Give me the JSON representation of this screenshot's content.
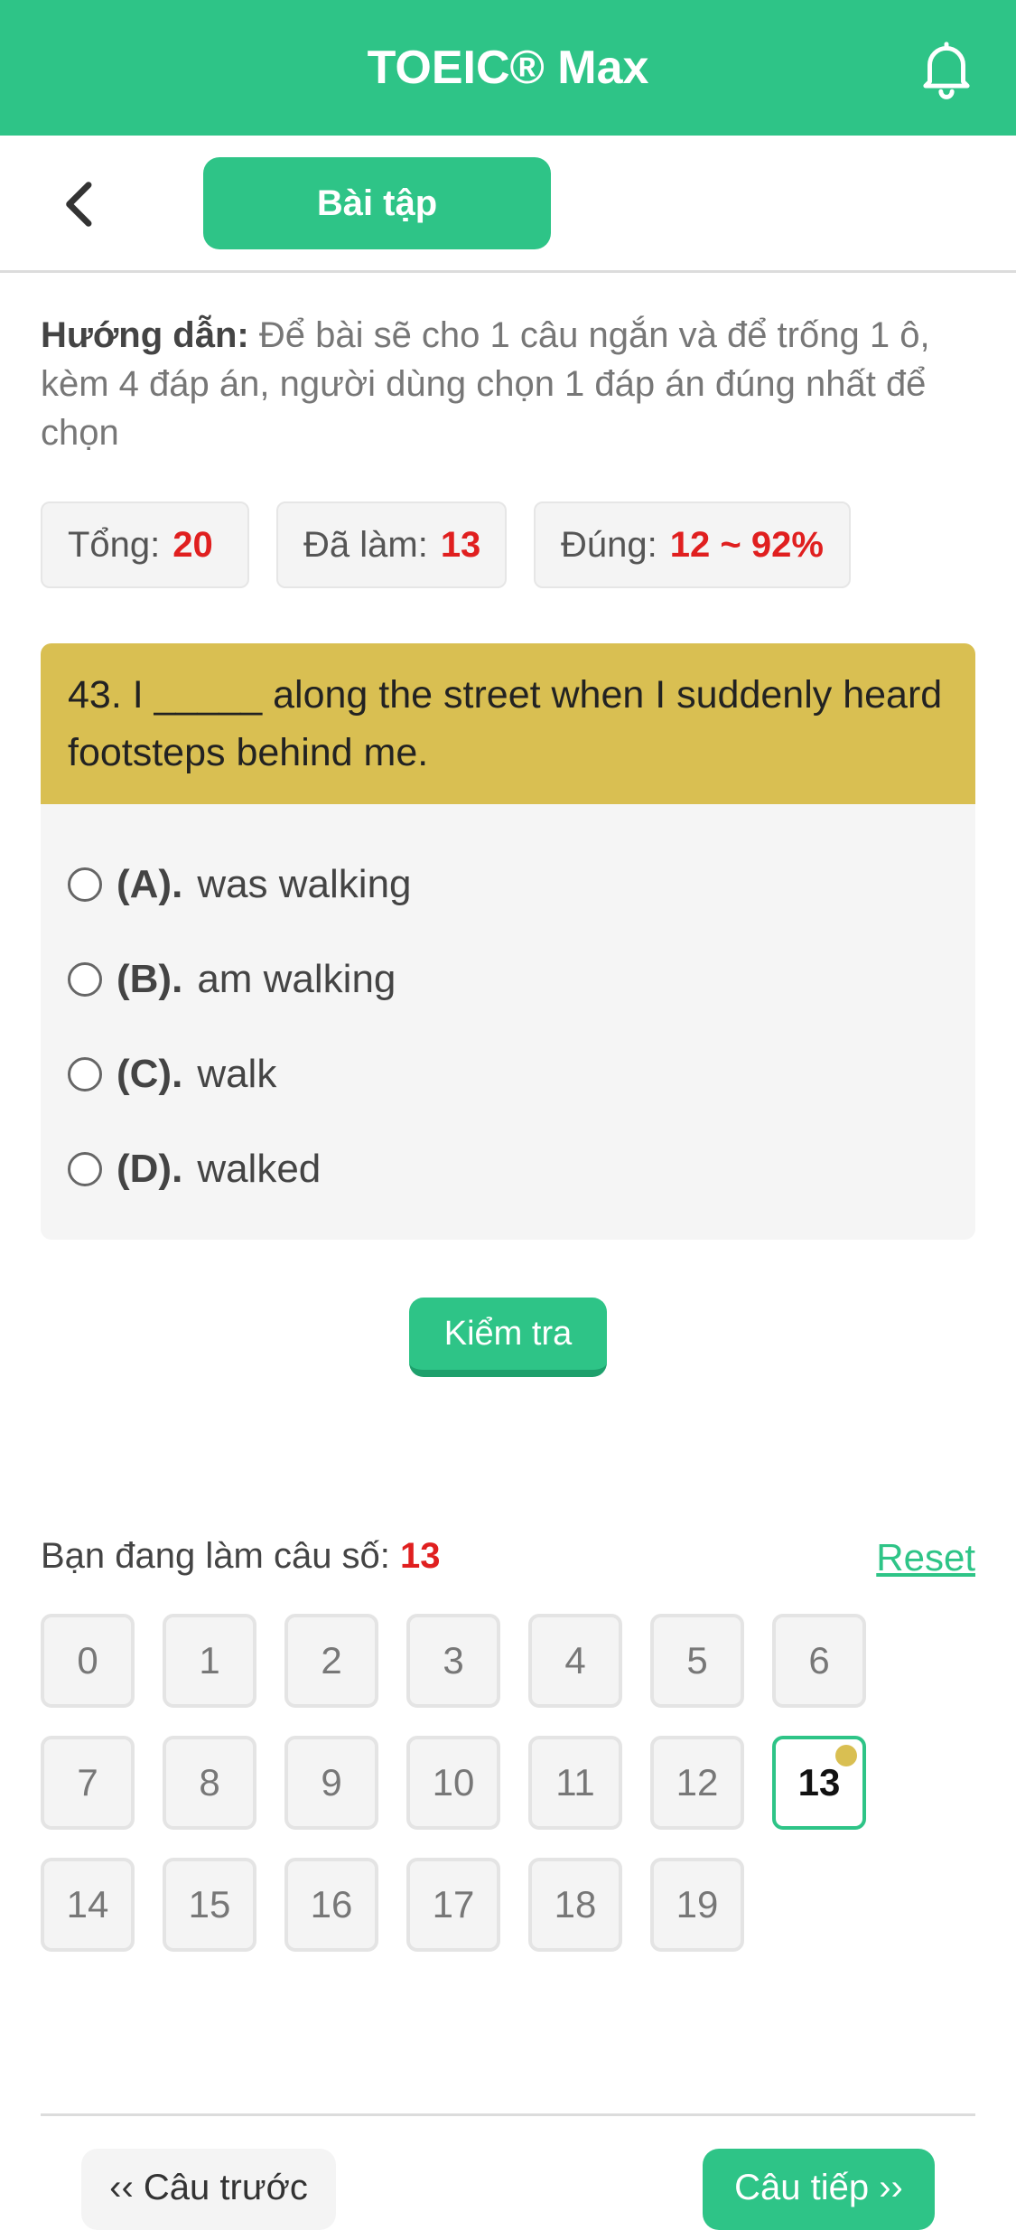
{
  "header": {
    "title": "TOEIC® Max",
    "notification_icon": "bell-icon"
  },
  "toolbar": {
    "back_icon": "chevron-left-icon",
    "tab_label": "Bài tập"
  },
  "instruction": {
    "label": "Hướng dẫn:",
    "text": "Để bài sẽ cho 1 câu ngắn và để trống 1 ô, kèm 4 đáp án, người dùng chọn 1 đáp án đúng nhất để chọn"
  },
  "stats": {
    "total_label": "Tổng:",
    "total_value": "20",
    "done_label": "Đã làm:",
    "done_value": "13",
    "correct_label": "Đúng:",
    "correct_value": "12 ~ 92%"
  },
  "question": {
    "text": "43. I _____ along the street when I suddenly heard footsteps behind me.",
    "options": [
      {
        "letter": "(A).",
        "text": "was walking"
      },
      {
        "letter": "(B).",
        "text": "am walking"
      },
      {
        "letter": "(C).",
        "text": "walk"
      },
      {
        "letter": "(D).",
        "text": "walked"
      }
    ]
  },
  "check_label": "Kiểm tra",
  "progress": {
    "label": "Bạn đang làm câu số:",
    "current": "13",
    "reset_label": "Reset"
  },
  "questions_grid": [
    "0",
    "1",
    "2",
    "3",
    "4",
    "5",
    "6",
    "7",
    "8",
    "9",
    "10",
    "11",
    "12",
    "13",
    "14",
    "15",
    "16",
    "17",
    "18",
    "19"
  ],
  "current_index": 13,
  "footer": {
    "prev_label": "‹‹ Câu trước",
    "next_label": "Câu tiếp ››"
  },
  "colors": {
    "brand": "#2ec487",
    "highlight": "#d9bf52",
    "accent_red": "#e01f1f"
  }
}
